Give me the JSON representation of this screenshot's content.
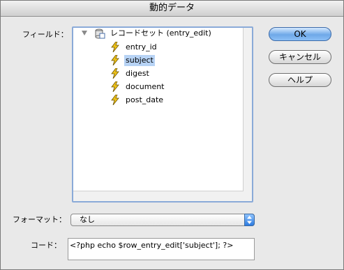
{
  "window": {
    "title": "動的データ"
  },
  "labels": {
    "field": "フィールド：",
    "format": "フォーマット：",
    "code": "コード："
  },
  "tree": {
    "recordset_label": "レコードセット (entry_edit)",
    "fields": [
      "entry_id",
      "subject",
      "digest",
      "document",
      "post_date"
    ],
    "selected": "subject"
  },
  "buttons": {
    "ok": "OK",
    "cancel": "キャンセル",
    "help": "ヘルプ"
  },
  "format": {
    "selected": "なし"
  },
  "code": {
    "value": "<?php echo $row_entry_edit['subject']; ?>"
  },
  "colors": {
    "selection": "#b7d3f5",
    "default_button": "#6ea8e8",
    "bolt": "#f0c419"
  }
}
